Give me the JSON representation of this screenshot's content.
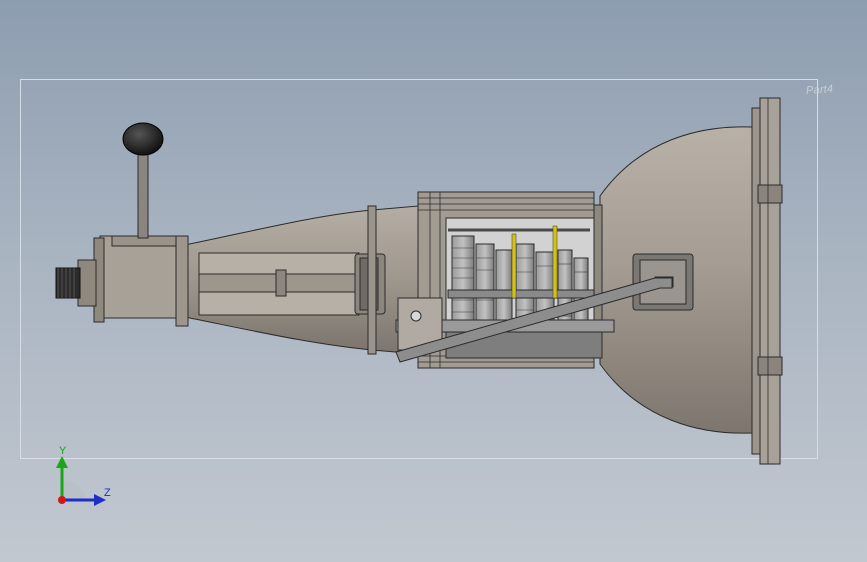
{
  "viewport": {
    "background_top": "#8d9db0",
    "background_bottom": "#c2c8d0",
    "configuration_label": "Part4"
  },
  "model": {
    "description_icon": "gearbox-assembly-icon",
    "colors": {
      "housing": "#a39a8f",
      "housing_dark": "#6e6a65",
      "gear": "#8c8c8c",
      "edge": "#2b2b2b",
      "shift_rod": "#d4c21a",
      "knob": "#1d1d1d"
    }
  },
  "triad": {
    "y_label": "Y",
    "z_label": "Z",
    "y_color": "#1aa51a",
    "z_color": "#1d2fc4",
    "x_color": "#d01818"
  }
}
